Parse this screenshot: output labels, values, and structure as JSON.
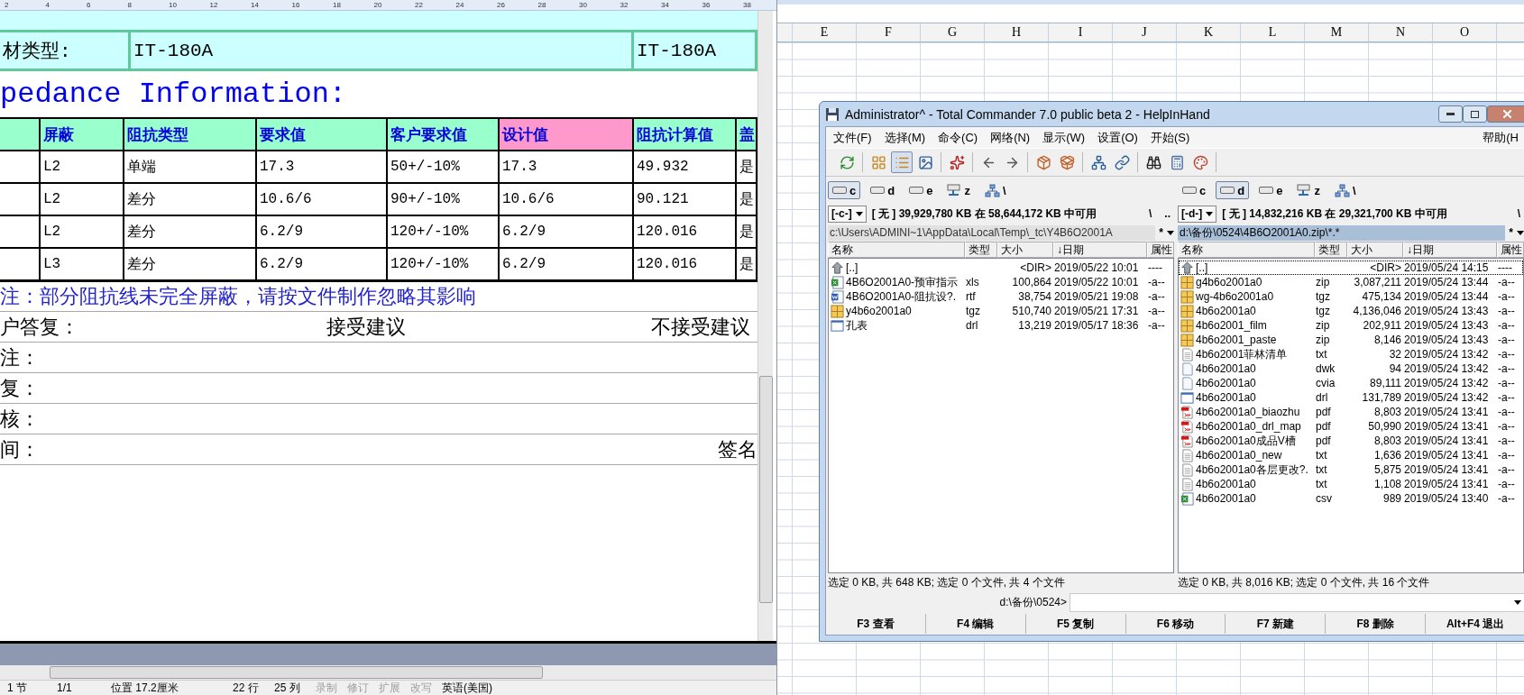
{
  "word": {
    "ruler": [
      "2",
      "4",
      "6",
      "8",
      "10",
      "12",
      "14",
      "16",
      "18",
      "20",
      "22",
      "24",
      "26",
      "28",
      "30",
      "32",
      "34",
      "36",
      "38"
    ],
    "material_row": {
      "label": "材类型:",
      "value": "IT-180A",
      "value_2": "IT-180A"
    },
    "heading": "pedance Information:",
    "impedance_table": {
      "columns": [
        {
          "label": "屏蔽",
          "color": "#99ffcc"
        },
        {
          "label": "阻抗类型",
          "color": "#99ffcc"
        },
        {
          "label": "要求值",
          "color": "#99ffcc"
        },
        {
          "label": "客户要求值",
          "color": "#99ffcc"
        },
        {
          "label": "设计值",
          "color": "#ff99cc"
        },
        {
          "label": "阻抗计算值",
          "color": "#99ffcc"
        },
        {
          "label": "盖",
          "color": "#99ffcc"
        }
      ],
      "rows": [
        [
          "L2",
          "单端",
          "17.3",
          "50+/-10%",
          "17.3",
          "49.932",
          "是"
        ],
        [
          "L2",
          "差分",
          "10.6/6",
          "90+/-10%",
          "10.6/6",
          "90.121",
          "是"
        ],
        [
          "L2",
          "差分",
          "6.2/9",
          "120+/-10%",
          "6.2/9",
          "120.016",
          "是"
        ],
        [
          "L3",
          "差分",
          "6.2/9",
          "120+/-10%",
          "6.2/9",
          "120.016",
          "是"
        ]
      ]
    },
    "note": "注：部分阻抗线未完全屏蔽，请按文件制作忽略其影响",
    "reply": {
      "label": "户答复：",
      "accept": "接受建议",
      "reject": "不接受建议"
    },
    "fields": [
      {
        "label": "注："
      },
      {
        "label": "复："
      },
      {
        "label": "核："
      },
      {
        "label": "间：",
        "signature": "签名"
      }
    ],
    "status_bar": {
      "section": "1 节",
      "page": "1/1",
      "position": "位置 17.2厘米",
      "line": "22 行",
      "column": "25 列",
      "modes": [
        {
          "label": "录制",
          "enabled": false
        },
        {
          "label": "修订",
          "enabled": false
        },
        {
          "label": "扩展",
          "enabled": false
        },
        {
          "label": "改写",
          "enabled": false
        }
      ],
      "language": "英语(美国)"
    }
  },
  "spreadsheet": {
    "columns": [
      "E",
      "F",
      "G",
      "H",
      "I",
      "J",
      "K",
      "L",
      "M",
      "N",
      "O"
    ]
  },
  "commander": {
    "title": "Administrator^ - Total Commander 7.0 public beta 2 - HelpInHand",
    "menu": [
      "文件(F)",
      "选择(M)",
      "命令(C)",
      "网络(N)",
      "显示(W)",
      "设置(O)",
      "开始(S)"
    ],
    "help_menu": "帮助(H",
    "toolbar": [
      [
        {
          "kind": "refresh",
          "pressed": false
        }
      ],
      [
        {
          "kind": "brief",
          "pressed": false
        },
        {
          "kind": "detailed",
          "pressed": true
        },
        {
          "kind": "thumbnails",
          "pressed": false
        }
      ],
      [
        {
          "kind": "sparkle",
          "pressed": false
        }
      ],
      [
        {
          "kind": "back",
          "pressed": false
        },
        {
          "kind": "forward",
          "pressed": false
        }
      ],
      [
        {
          "kind": "pack",
          "pressed": false
        },
        {
          "kind": "unpack",
          "pressed": false
        }
      ],
      [
        {
          "kind": "ftp",
          "pressed": false
        },
        {
          "kind": "url",
          "pressed": false
        }
      ],
      [
        {
          "kind": "search",
          "pressed": false
        },
        {
          "kind": "calculator",
          "pressed": false
        },
        {
          "kind": "palette",
          "pressed": false
        }
      ]
    ],
    "panels": [
      {
        "drives": [
          {
            "letter": "c",
            "kind": "local",
            "selected": true
          },
          {
            "letter": "d",
            "kind": "local",
            "selected": false
          },
          {
            "letter": "e",
            "kind": "local",
            "selected": false
          },
          {
            "letter": "z",
            "kind": "network",
            "selected": false
          },
          {
            "letter": "\\",
            "kind": "root",
            "selected": false
          }
        ],
        "drive_combo": "[-c-]",
        "free_space": "[ 无 ]  39,929,780 KB 在 58,644,172 KB 中可用",
        "root_button": "\\",
        "parent_button": "..",
        "path": "c:\\Users\\ADMINI~1\\AppData\\Local\\Temp\\_tc\\Y4B6O2001A",
        "path_active": false,
        "filter_button": "*",
        "columns": [
          "名称",
          "类型",
          "大小",
          "↓日期",
          "属性"
        ],
        "files": [
          {
            "kind": "up",
            "name": "[..]",
            "size": "<DIR>",
            "date": "2019/05/22 10:01",
            "attr": "----",
            "cursor": false
          },
          {
            "kind": "spreadsheet",
            "name": "4B6O2001A0-预审指示",
            "type": "xls",
            "size": "100,864",
            "date": "2019/05/22 10:01",
            "attr": "-a--",
            "cursor": false
          },
          {
            "kind": "document",
            "name": "4B6O2001A0-阻抗设?.",
            "type": "rtf",
            "size": "38,754",
            "date": "2019/05/21 19:08",
            "attr": "-a--",
            "cursor": false
          },
          {
            "kind": "archive",
            "name": "y4b6o2001a0",
            "type": "tgz",
            "size": "510,740",
            "date": "2019/05/21 17:31",
            "attr": "-a--",
            "cursor": false
          },
          {
            "kind": "window",
            "name": "孔表",
            "type": "drl",
            "size": "13,219",
            "date": "2019/05/17 18:36",
            "attr": "-a--",
            "cursor": false
          }
        ],
        "status": "选定 0 KB, 共 648 KB; 选定 0 个文件, 共 4 个文件"
      },
      {
        "drives": [
          {
            "letter": "c",
            "kind": "local",
            "selected": false
          },
          {
            "letter": "d",
            "kind": "local",
            "selected": true
          },
          {
            "letter": "e",
            "kind": "local",
            "selected": false
          },
          {
            "letter": "z",
            "kind": "network",
            "selected": false
          },
          {
            "letter": "\\",
            "kind": "root",
            "selected": false
          }
        ],
        "drive_combo": "[-d-]",
        "free_space": "[ 无 ]  14,832,216 KB 在 29,321,700 KB 中可用",
        "root_button": "\\",
        "path": "d:\\备份\\0524\\4B6O2001A0.zip\\*.*",
        "path_active": true,
        "filter_button": "*",
        "columns": [
          "名称",
          "类型",
          "大小",
          "↓日期",
          "属性"
        ],
        "files": [
          {
            "kind": "up",
            "name": "[..]",
            "size": "<DIR>",
            "date": "2019/05/24 14:15",
            "attr": "----",
            "cursor": true
          },
          {
            "kind": "archive",
            "name": "g4b6o2001a0",
            "type": "zip",
            "size": "3,087,211",
            "date": "2019/05/24 13:44",
            "attr": "-a--",
            "cursor": false
          },
          {
            "kind": "archive",
            "name": "wg-4b6o2001a0",
            "type": "tgz",
            "size": "475,134",
            "date": "2019/05/24 13:44",
            "attr": "-a--",
            "cursor": false
          },
          {
            "kind": "archive",
            "name": "4b6o2001a0",
            "type": "tgz",
            "size": "4,136,046",
            "date": "2019/05/24 13:43",
            "attr": "-a--",
            "cursor": false
          },
          {
            "kind": "archive",
            "name": "4b6o2001_film",
            "type": "zip",
            "size": "202,911",
            "date": "2019/05/24 13:43",
            "attr": "-a--",
            "cursor": false
          },
          {
            "kind": "archive",
            "name": "4b6o2001_paste",
            "type": "zip",
            "size": "8,146",
            "date": "2019/05/24 13:43",
            "attr": "-a--",
            "cursor": false
          },
          {
            "kind": "text",
            "name": "4b6o2001菲林清单",
            "type": "txt",
            "size": "32",
            "date": "2019/05/24 13:42",
            "attr": "-a--",
            "cursor": false
          },
          {
            "kind": "file",
            "name": "4b6o2001a0",
            "type": "dwk",
            "size": "94",
            "date": "2019/05/24 13:42",
            "attr": "-a--",
            "cursor": false
          },
          {
            "kind": "file",
            "name": "4b6o2001a0",
            "type": "cvia",
            "size": "89,111",
            "date": "2019/05/24 13:42",
            "attr": "-a--",
            "cursor": false
          },
          {
            "kind": "window",
            "name": "4b6o2001a0",
            "type": "drl",
            "size": "131,789",
            "date": "2019/05/24 13:42",
            "attr": "-a--",
            "cursor": false
          },
          {
            "kind": "pdf",
            "name": "4b6o2001a0_biaozhu",
            "type": "pdf",
            "size": "8,803",
            "date": "2019/05/24 13:41",
            "attr": "-a--",
            "cursor": false
          },
          {
            "kind": "pdf",
            "name": "4b6o2001a0_drl_map",
            "type": "pdf",
            "size": "50,990",
            "date": "2019/05/24 13:41",
            "attr": "-a--",
            "cursor": false
          },
          {
            "kind": "pdf",
            "name": "4b6o2001a0成品V槽",
            "type": "pdf",
            "size": "8,803",
            "date": "2019/05/24 13:41",
            "attr": "-a--",
            "cursor": false
          },
          {
            "kind": "text",
            "name": "4b6o2001a0_new",
            "type": "txt",
            "size": "1,636",
            "date": "2019/05/24 13:41",
            "attr": "-a--",
            "cursor": false
          },
          {
            "kind": "text",
            "name": "4b6o2001a0各层更改?.",
            "type": "txt",
            "size": "5,875",
            "date": "2019/05/24 13:41",
            "attr": "-a--",
            "cursor": false
          },
          {
            "kind": "text",
            "name": "4b6o2001a0",
            "type": "txt",
            "size": "1,108",
            "date": "2019/05/24 13:41",
            "attr": "-a--",
            "cursor": false
          },
          {
            "kind": "spreadsheet",
            "name": "4b6o2001a0",
            "type": "csv",
            "size": "989",
            "date": "2019/05/24 13:40",
            "attr": "-a--",
            "cursor": false
          }
        ],
        "status": "选定 0 KB, 共 8,016 KB; 选定 0 个文件, 共 16 个文件"
      }
    ],
    "command_prompt": "d:\\备份\\0524>",
    "function_keys": [
      "F3 查看",
      "F4 编辑",
      "F5 复制",
      "F6 移动",
      "F7 新建",
      "F8 删除",
      "Alt+F4 退出"
    ]
  }
}
